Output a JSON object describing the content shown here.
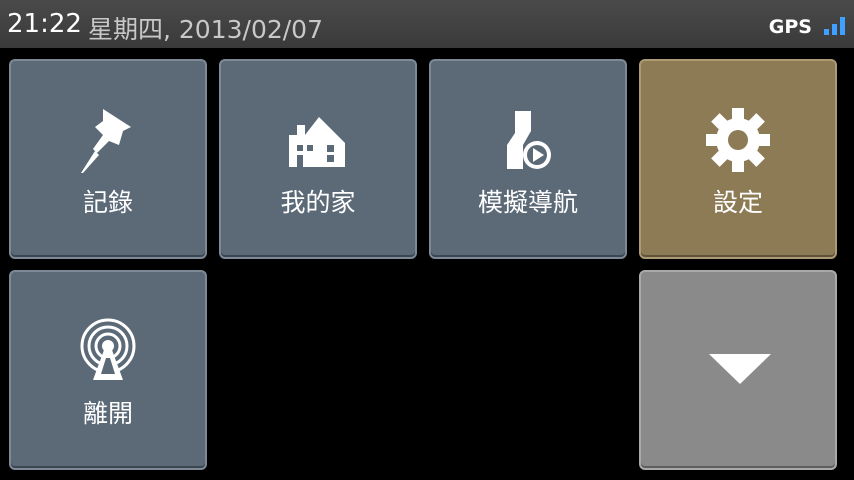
{
  "status": {
    "time": "21:22",
    "date": "星期四, 2013/02/07",
    "gps_label": "GPS",
    "signal_icon": "signal-bars-icon",
    "signal_color": "#3fa0ff"
  },
  "tiles": [
    {
      "label": "記錄",
      "icon": "pushpin-icon"
    },
    {
      "label": "我的家",
      "icon": "home-icon"
    },
    {
      "label": "模擬導航",
      "icon": "navigation-simulation-icon"
    },
    {
      "label": "設定",
      "icon": "gear-icon"
    },
    {
      "label": "離開",
      "icon": "antenna-icon"
    },
    {
      "label": "",
      "icon": "chevron-down-icon"
    }
  ],
  "colors": {
    "tile": "#5c6a78",
    "tile_active": "#8d7b56",
    "tile_more": "#8a8a8a",
    "background": "#000000"
  }
}
